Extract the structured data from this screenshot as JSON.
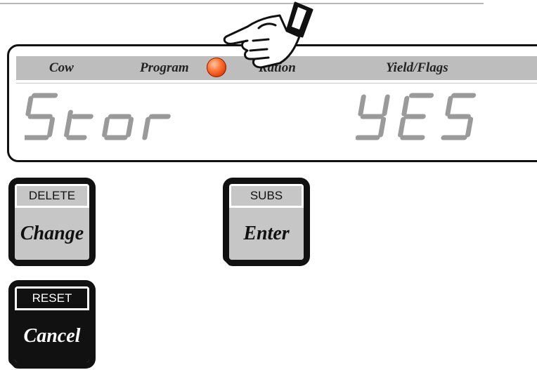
{
  "tabs": {
    "cow": "Cow",
    "program": "Program",
    "ration": "Ration",
    "yield_flags": "Yield/Flags"
  },
  "indicator": {
    "active_tab": "Program",
    "color": "#e3400a"
  },
  "display": {
    "left_text": "Stor",
    "right_text": "YES"
  },
  "keys": {
    "change": {
      "secondary": "DELETE",
      "primary": "Change"
    },
    "enter": {
      "secondary": "SUBS",
      "primary": "Enter"
    },
    "cancel": {
      "secondary": "RESET",
      "primary": "Cancel"
    }
  },
  "icons": {
    "pointer": "pointing-hand-icon",
    "led": "indicator-led-icon"
  }
}
